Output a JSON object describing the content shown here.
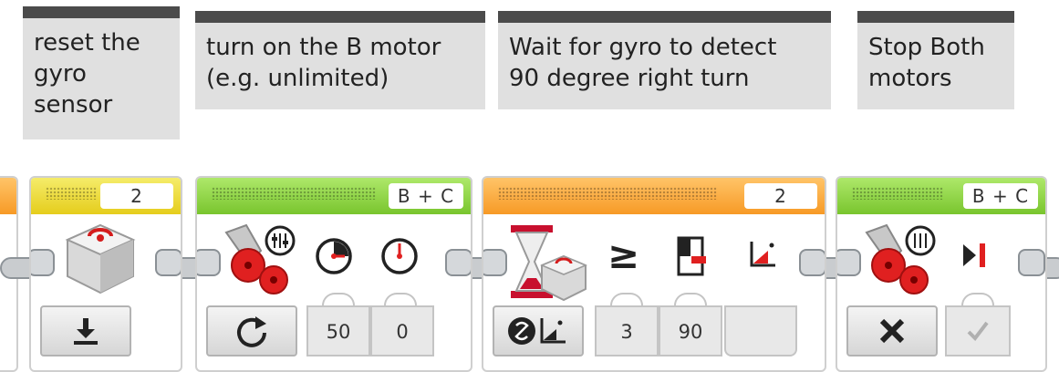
{
  "comments": [
    {
      "text": "reset the\ngyro\nsensor"
    },
    {
      "text": "turn on the B motor\n(e.g. unlimited)"
    },
    {
      "text": "Wait for gyro to detect\n90 degree right turn"
    },
    {
      "text": "Stop Both\nmotors"
    }
  ],
  "blocks": {
    "gyro_reset": {
      "port": "2"
    },
    "motor_on": {
      "ports": "B + C",
      "param1": "50",
      "param2": "0"
    },
    "wait_gyro": {
      "port": "2",
      "param1": "3",
      "param2": "90",
      "compare_symbol": "≥"
    },
    "motor_stop": {
      "ports": "B + C"
    }
  },
  "colors": {
    "yellow": "#e5cd1c",
    "green": "#79c52e",
    "orange": "#f79a26",
    "red": "#e02020"
  },
  "icons": [
    "gyro-sensor-icon",
    "reset-download-icon",
    "large-motor-icon",
    "adjust-icon",
    "speed-gauge-icon",
    "gauge-icon",
    "loop-arrow-icon",
    "hourglass-icon",
    "greater-equal-icon",
    "compare-icon",
    "rate-graph-icon",
    "mode-icon",
    "stop-icon",
    "close-icon",
    "check-icon"
  ]
}
